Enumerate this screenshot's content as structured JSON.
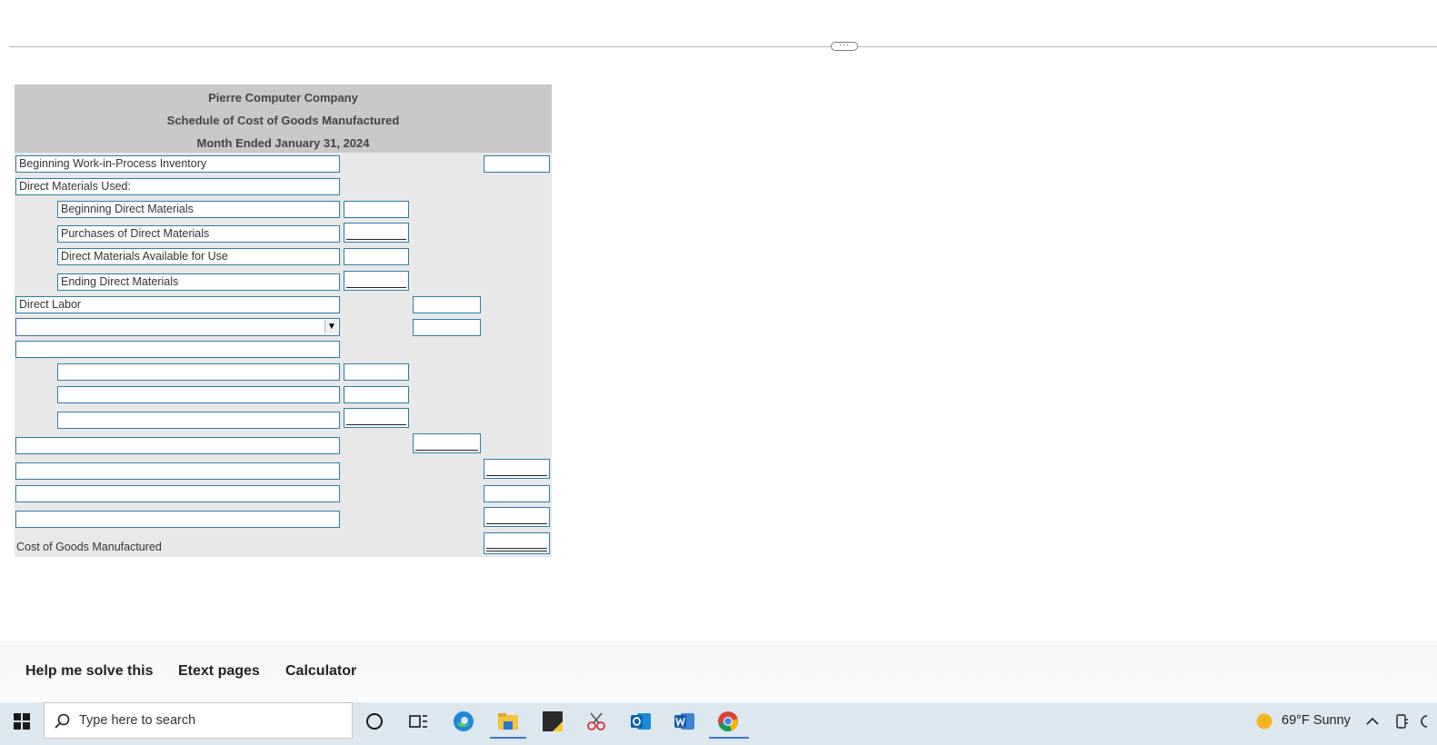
{
  "schedule": {
    "company": "Pierre Computer Company",
    "title": "Schedule of Cost of Goods Manufactured",
    "period": "Month Ended January 31, 2024",
    "rows": {
      "beginning_wip": "Beginning Work-in-Process Inventory",
      "dm_used": "Direct Materials Used:",
      "beginning_dm": "Beginning Direct Materials",
      "purchases_dm": "Purchases of Direct Materials",
      "dm_available": "Direct Materials Available for Use",
      "ending_dm": "Ending Direct Materials",
      "direct_labor": "Direct Labor",
      "cogm": "Cost of Goods Manufactured"
    },
    "dropdown_value": ""
  },
  "bottom_tools": {
    "help": "Help me solve this",
    "etext": "Etext pages",
    "calculator": "Calculator"
  },
  "taskbar": {
    "search_placeholder": "Type here to search",
    "weather": "69°F  Sunny"
  },
  "colors": {
    "field_border": "#2a7fa6",
    "header_bg": "#c8c8c8",
    "sheet_bg": "#e8e8e8",
    "taskbar_bg": "#dde7ef"
  }
}
